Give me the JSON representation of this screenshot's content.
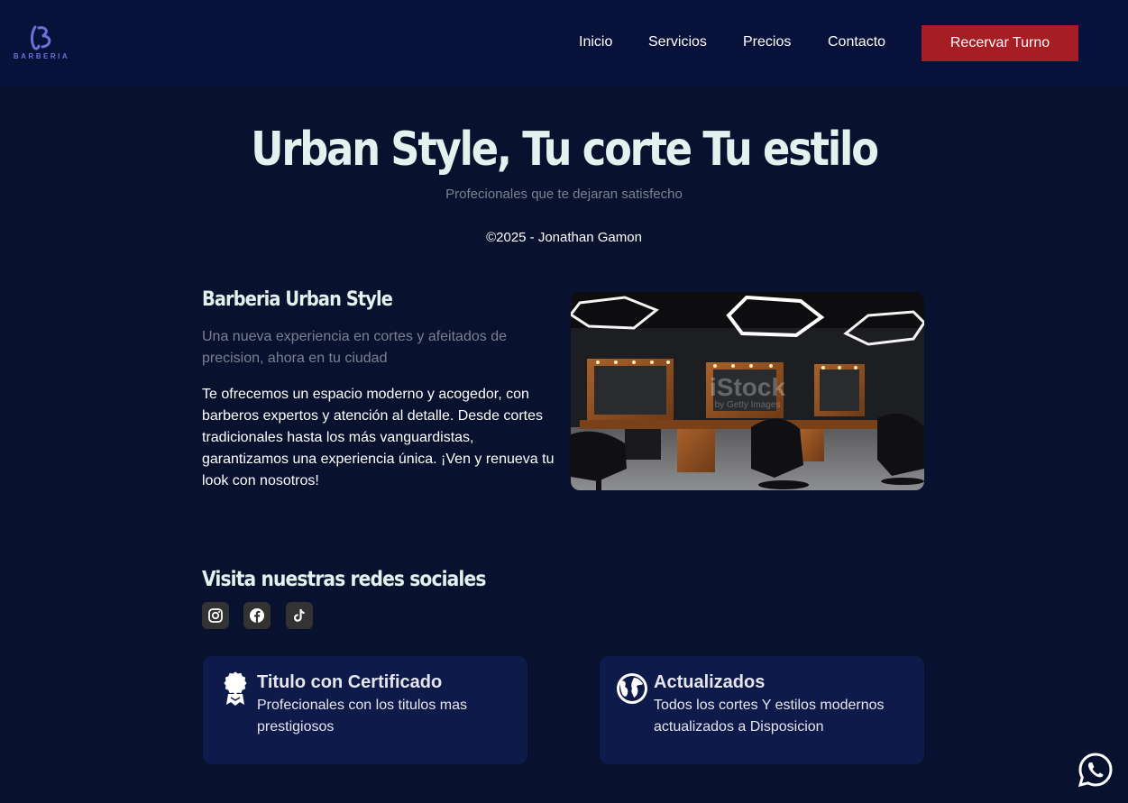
{
  "brand": {
    "logo_text": "BARBERIA"
  },
  "nav": {
    "items": [
      {
        "label": "Inicio"
      },
      {
        "label": "Servicios"
      },
      {
        "label": "Precios"
      },
      {
        "label": "Contacto"
      }
    ],
    "cta_label": "Recervar Turno"
  },
  "hero": {
    "title": "Urban Style, Tu corte Tu estilo",
    "subtitle": "Profecionales que te dejaran satisfecho",
    "copyright": "©2025 - Jonathan Gamon"
  },
  "about": {
    "title": "Barberia Urban Style",
    "lead": "Una nueva experiencia en cortes y afeitados de precision, ahora en tu ciudad",
    "body": "Te ofrecemos un espacio moderno y acogedor, con barberos expertos y atención al detalle. Desde cortes tradicionales hasta los más vanguardistas, garantizamos una experiencia única. ¡Ven y renueva tu look con nosotros!",
    "image_watermark": "iStock",
    "image_watermark_sub": "by Getty Images"
  },
  "social": {
    "title": "Visita nuestras redes sociales",
    "icons": [
      "instagram-icon",
      "facebook-icon",
      "tiktok-icon"
    ]
  },
  "cards": [
    {
      "icon": "award-icon",
      "title": "Titulo con Certificado",
      "description": "Profecionales con los titulos mas prestigiosos"
    },
    {
      "icon": "globe-icon",
      "title": "Actualizados",
      "description": "Todos los cortes Y estilos modernos actualizados a Disposicion"
    }
  ],
  "floating": {
    "icon": "whatsapp-icon"
  },
  "colors": {
    "background": "#08112e",
    "navbar": "#07113a",
    "accent_button": "#a71d24",
    "card": "#0e1a4a",
    "heading": "#e4f1ee",
    "muted_text": "#7b8091",
    "logo": "#6e6fd8"
  }
}
